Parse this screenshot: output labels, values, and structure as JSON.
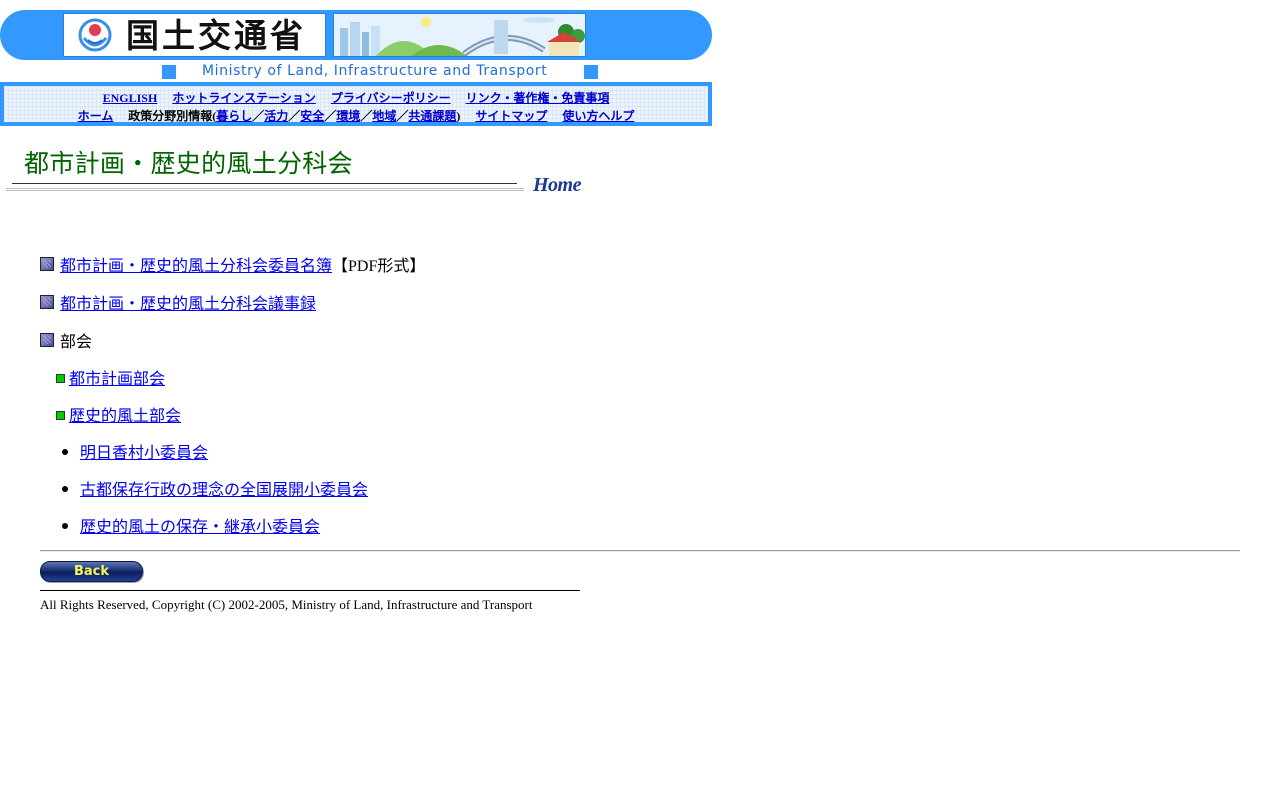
{
  "header": {
    "logo_text": "国土交通省",
    "ministry_name": "Ministry of Land, Infrastructure and Transport",
    "colors": {
      "banner": "#3399ff",
      "ministry_text": "#1f6fd6"
    }
  },
  "nav": {
    "row1": [
      "ENGLISH",
      "ホットラインステーション",
      "プライバシーポリシー",
      "リンク・著作権・免責事項"
    ],
    "row2": {
      "home": "ホーム",
      "policy_prefix": "政策分野別情報(",
      "policy_items": [
        "暮らし",
        "活力",
        "安全",
        "環境",
        "地域",
        "共通課題"
      ],
      "separator": "／",
      "policy_suffix": ")",
      "sitemap": "サイトマップ",
      "help": "使い方ヘルプ"
    }
  },
  "page": {
    "title": "都市計画・歴史的風土分科会",
    "home_link": "Home",
    "title_color": "#006400"
  },
  "content": {
    "roster_link": "都市計画・歴史的風土分科会委員名簿",
    "roster_suffix": "【PDF形式】",
    "minutes_link": "都市計画・歴史的風土分科会議事録",
    "subcommittee_label": "部会",
    "subcommittees": [
      "都市計画部会",
      "歴史的風土部会"
    ],
    "committees": [
      "明日香村小委員会",
      "古都保存行政の理念の全国展開小委員会",
      "歴史的風土の保存・継承小委員会"
    ]
  },
  "footer": {
    "back_label": "Back",
    "copyright": "All Rights Reserved, Copyright (C) 2002-2005, Ministry of Land, Infrastructure and Transport"
  }
}
